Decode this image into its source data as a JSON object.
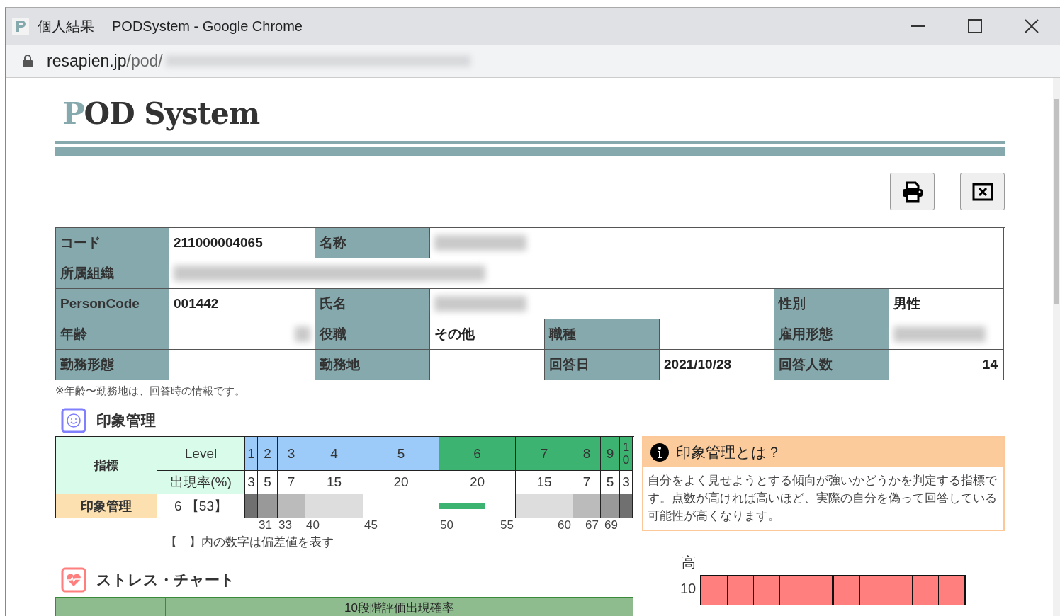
{
  "browser": {
    "page_title": "個人結果",
    "app_title": "PODSystem - Google Chrome",
    "url_host": "resapien.jp",
    "url_path": "/pod/"
  },
  "logo": "POD System",
  "info_table": {
    "rows": [
      [
        {
          "kind": "label",
          "text": "コード"
        },
        {
          "kind": "value",
          "text": "211000004065"
        },
        {
          "kind": "label",
          "text": "名称"
        },
        {
          "kind": "blurred"
        },
        {
          "kind": "merged"
        },
        {
          "kind": "merged"
        },
        {
          "kind": "merged"
        },
        {
          "kind": "merged"
        }
      ],
      [
        {
          "kind": "label",
          "text": "所属組織"
        },
        {
          "kind": "blurred"
        },
        {
          "kind": "merged"
        },
        {
          "kind": "merged"
        },
        {
          "kind": "merged"
        },
        {
          "kind": "merged"
        },
        {
          "kind": "merged"
        },
        {
          "kind": "merged"
        }
      ],
      [
        {
          "kind": "label",
          "text": "PersonCode"
        },
        {
          "kind": "value",
          "text": "001442"
        },
        {
          "kind": "label",
          "text": "氏名"
        },
        {
          "kind": "blurred"
        },
        {
          "kind": "merged"
        },
        {
          "kind": "merged"
        },
        {
          "kind": "label",
          "text": "性別"
        },
        {
          "kind": "value",
          "text": "男性"
        }
      ],
      [
        {
          "kind": "label",
          "text": "年齢"
        },
        {
          "kind": "blurred"
        },
        {
          "kind": "label",
          "text": "役職"
        },
        {
          "kind": "value",
          "text": "その他"
        },
        {
          "kind": "label",
          "text": "職種"
        },
        {
          "kind": "value"
        },
        {
          "kind": "label",
          "text": "雇用形態"
        },
        {
          "kind": "blurred"
        }
      ],
      [
        {
          "kind": "label",
          "text": "勤務形態"
        },
        {
          "kind": "value"
        },
        {
          "kind": "label",
          "text": "勤務地"
        },
        {
          "kind": "value"
        },
        {
          "kind": "label",
          "text": "回答日"
        },
        {
          "kind": "value",
          "text": "2021/10/28"
        },
        {
          "kind": "label",
          "text": "回答人数"
        },
        {
          "kind": "number",
          "text": "14"
        }
      ]
    ],
    "note": "※年齢〜勤務地は、回答時の情報です。"
  },
  "impression": {
    "title": "印象管理",
    "index_header": "指標",
    "level_header": "Level",
    "rate_header": "出現率(%)",
    "row_label": "印象管理",
    "score": "6 【53】",
    "levels": [
      {
        "label": "1",
        "rate": "3",
        "color": "#9ccbfa",
        "band": {
          "color": "#707070"
        }
      },
      {
        "label": "2",
        "rate": "5",
        "color": "#9ccbfa",
        "band": {
          "color": "#999999"
        },
        "ticks": [
          "31"
        ]
      },
      {
        "label": "3",
        "rate": "7",
        "color": "#9ccbfa",
        "band": {
          "color": "#bbbbbb"
        },
        "ticks": [
          "33"
        ]
      },
      {
        "label": "4",
        "rate": "15",
        "color": "#9ccbfa",
        "band": {
          "color": "#dddddd"
        },
        "ticks": [
          "40"
        ]
      },
      {
        "label": "5",
        "rate": "20",
        "color": "#9ccbfa",
        "band": {
          "color": "#ffffff"
        },
        "ticks": [
          "45"
        ]
      },
      {
        "label": "6",
        "rate": "20",
        "color": "#3cb371",
        "band": {
          "color": "#ffffff",
          "level": 0.6
        },
        "ticks": [
          "50",
          "55"
        ]
      },
      {
        "label": "7",
        "rate": "15",
        "color": "#3cb371",
        "band": {
          "color": "#dddddd"
        },
        "ticks": [
          "60"
        ]
      },
      {
        "label": "8",
        "rate": "7",
        "color": "#3cb371",
        "band": {
          "color": "#bbbbbb"
        },
        "ticks": [
          "67"
        ]
      },
      {
        "label": "9",
        "rate": "5",
        "color": "#3cb371",
        "band": {
          "color": "#999999"
        },
        "ticks": [
          "69"
        ]
      },
      {
        "label": "10",
        "rate": "3",
        "color": "#3cb371",
        "band": {
          "color": "#707070"
        }
      }
    ],
    "footnote": "【　】内の数字は偏差値を表す",
    "info": {
      "title": "印象管理とは？",
      "body": "自分をよく見せようとする傾向が強いかどうかを判定する指標です。点数が高ければ高いほど、実際の自分を偽って回答している可能性が高くなります。"
    }
  },
  "stress": {
    "title": "ストレス・チャート",
    "table_header": "10段階評価出現確率",
    "chart": {
      "top_label": "高",
      "rows": [
        {
          "label": "10",
          "cells": [
            {
              "filled": true
            },
            {
              "filled": true
            },
            {
              "filled": true
            },
            {
              "filled": true
            },
            {
              "filled": true
            },
            {
              "filled": true
            },
            {
              "filled": true
            },
            {
              "filled": true
            },
            {
              "filled": true
            },
            {
              "filled": true
            }
          ]
        }
      ]
    }
  }
}
